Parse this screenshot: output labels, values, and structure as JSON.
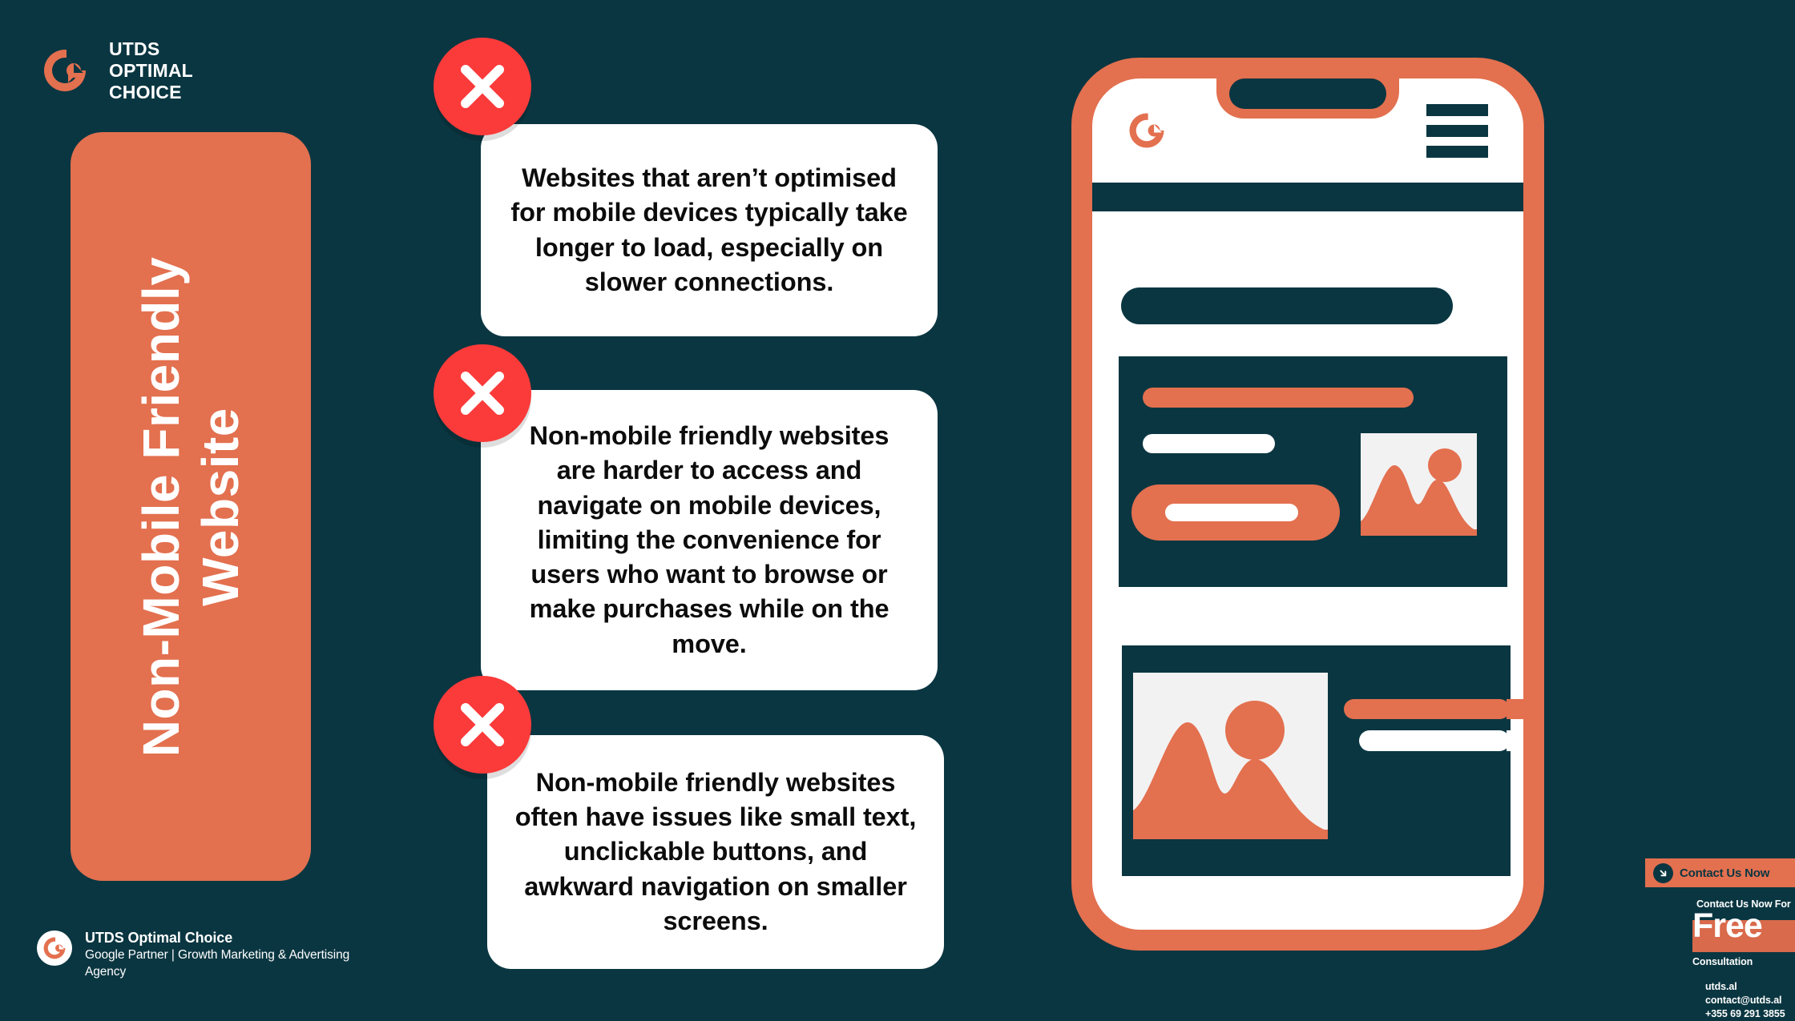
{
  "colors": {
    "background": "#0a3641",
    "accent_orange": "#e3704f",
    "white": "#ffffff",
    "error_red": "#fb3a3a",
    "thumb_bg": "#f2f2f2"
  },
  "brand": {
    "name": "UTDS\nOPTIMAL\nCHOICE",
    "logo_icon": "utds-c-logo-icon"
  },
  "vertical_panel": {
    "title": "Non-Mobile Friendly\nWebsite"
  },
  "bubbles": [
    {
      "icon": "red-x-circle-icon",
      "text": "Websites that aren’t optimised for mobile devices typically take longer to load, especially on slower connections."
    },
    {
      "icon": "red-x-circle-icon",
      "text": "Non-mobile friendly websites are harder to access and navigate on mobile devices, limiting the convenience for users who want to browse or make purchases while on the move."
    },
    {
      "icon": "red-x-circle-icon",
      "text": "Non-mobile friendly websites often have issues like small text, unclickable buttons, and awkward navigation on smaller screens."
    }
  ],
  "phone": {
    "appbar": {
      "logo_icon": "utds-c-logo-icon",
      "menu_icon": "hamburger-menu-icon"
    },
    "cards": [
      {
        "thumbnail_icon": "image-placeholder-icon",
        "layout": "text-left-image-right"
      },
      {
        "thumbnail_icon": "image-placeholder-icon",
        "layout": "image-left-text-right"
      }
    ]
  },
  "cta": {
    "button_label": "Contact Us Now",
    "arrow_icon": "arrow-down-right-icon",
    "line_1": "Contact Us Now For",
    "highlight": "Free",
    "line_2": "Consultation",
    "contact": "utds.al\ncontact@utds.al\n+355 69 291 3855"
  },
  "footer": {
    "logo_icon": "utds-c-logo-icon",
    "name": "UTDS Optimal Choice",
    "tagline": "Google Partner | Growth Marketing & Advertising Agency"
  }
}
